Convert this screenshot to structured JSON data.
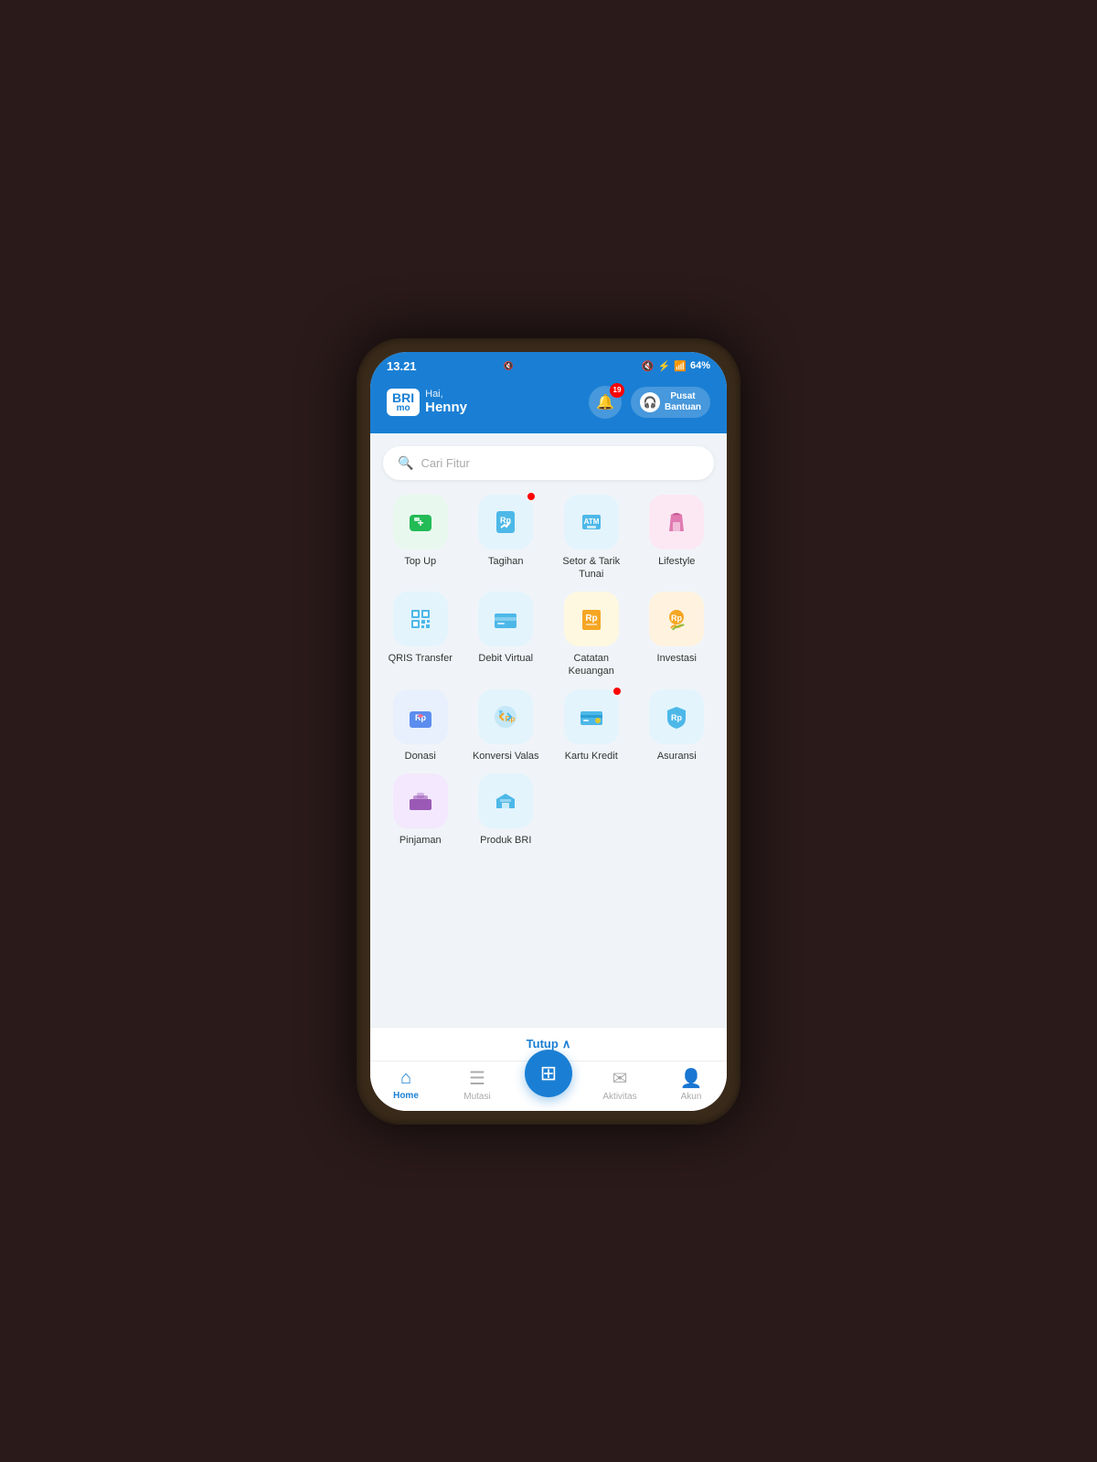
{
  "statusBar": {
    "time": "13.21",
    "battery": "64%",
    "icons": [
      "🔇",
      "🔵",
      "📶",
      "🔋"
    ]
  },
  "header": {
    "appName": "BRI",
    "appSub": "mo",
    "greeting": "Hai,",
    "userName": "Henny",
    "notifCount": "19",
    "supportLabel": "Pusat\nBantuan"
  },
  "search": {
    "placeholder": "Cari Fitur"
  },
  "features": [
    {
      "id": "topup",
      "label": "Top Up",
      "iconClass": "icon-topup",
      "hasDot": false
    },
    {
      "id": "tagihan",
      "label": "Tagihan",
      "iconClass": "icon-tagihan",
      "hasDot": true
    },
    {
      "id": "setor",
      "label": "Setor &\nTarik Tunai",
      "iconClass": "icon-setor",
      "hasDot": false
    },
    {
      "id": "lifestyle",
      "label": "Lifestyle",
      "iconClass": "icon-lifestyle",
      "hasDot": false
    },
    {
      "id": "qris",
      "label": "QRIS\nTransfer",
      "iconClass": "icon-qris",
      "hasDot": false
    },
    {
      "id": "debit",
      "label": "Debit\nVirtual",
      "iconClass": "icon-debit",
      "hasDot": false
    },
    {
      "id": "catatan",
      "label": "Catatan\nKeuangan",
      "iconClass": "icon-catatan",
      "hasDot": false
    },
    {
      "id": "investasi",
      "label": "Investasi",
      "iconClass": "icon-investasi",
      "hasDot": false
    },
    {
      "id": "donasi",
      "label": "Donasi",
      "iconClass": "icon-donasi",
      "hasDot": false
    },
    {
      "id": "konversi",
      "label": "Konversi\nValas",
      "iconClass": "icon-konversi",
      "hasDot": false
    },
    {
      "id": "kartu",
      "label": "Kartu Kredit",
      "iconClass": "icon-kartu",
      "hasDot": true
    },
    {
      "id": "asuransi",
      "label": "Asuransi",
      "iconClass": "icon-asuransi",
      "hasDot": false
    },
    {
      "id": "pinjaman",
      "label": "Pinjaman",
      "iconClass": "icon-pinjaman",
      "hasDot": false
    },
    {
      "id": "produk",
      "label": "Produk BRI",
      "iconClass": "icon-produk",
      "hasDot": false
    }
  ],
  "bottomBar": {
    "tutupLabel": "Tutup"
  },
  "nav": {
    "items": [
      {
        "id": "home",
        "label": "Home",
        "active": true
      },
      {
        "id": "mutasi",
        "label": "Mutasi",
        "active": false
      },
      {
        "id": "qris-center",
        "label": "",
        "active": false
      },
      {
        "id": "aktivitas",
        "label": "Aktivitas",
        "active": false
      },
      {
        "id": "akun",
        "label": "Akun",
        "active": false
      }
    ]
  }
}
